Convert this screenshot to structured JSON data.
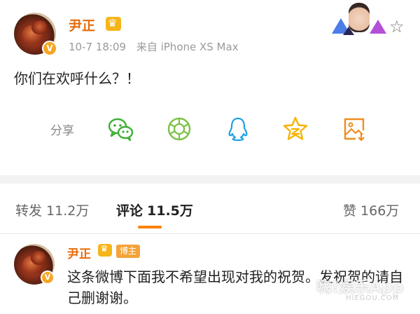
{
  "post": {
    "author": "尹正",
    "date": "10-7 18:09",
    "source": "来自 iPhone XS Max",
    "text": "你们在欢呼什么？！",
    "verified_mark": "V",
    "share_label": "分享",
    "share_icons": [
      "wechat-icon",
      "moments-icon",
      "qq-icon",
      "qzone-icon",
      "save-image-icon"
    ]
  },
  "tabs": {
    "repost_label": "转发",
    "repost_count": "11.2万",
    "comment_label": "评论",
    "comment_count": "11.5万",
    "like_label": "赞",
    "like_count": "166万"
  },
  "comment": {
    "author": "尹正",
    "badge": "博主",
    "verified_mark": "V",
    "text": "这条微博下面我不希望出现对我的祝贺。发祝贺的请自己删谢谢。"
  },
  "watermark": {
    "text": "嗨!娱乐App",
    "sub": "HIEGOU.COM"
  },
  "colors": {
    "author": "#e86b0a",
    "tab_underline": "#ff8200",
    "crown": "#f6b519",
    "host_badge": "#f3a33a",
    "wechat": "#3cb035",
    "moments": "#7bc144",
    "qq": "#1da1e2",
    "qzone": "#f5b400",
    "save": "#f08c1e"
  }
}
